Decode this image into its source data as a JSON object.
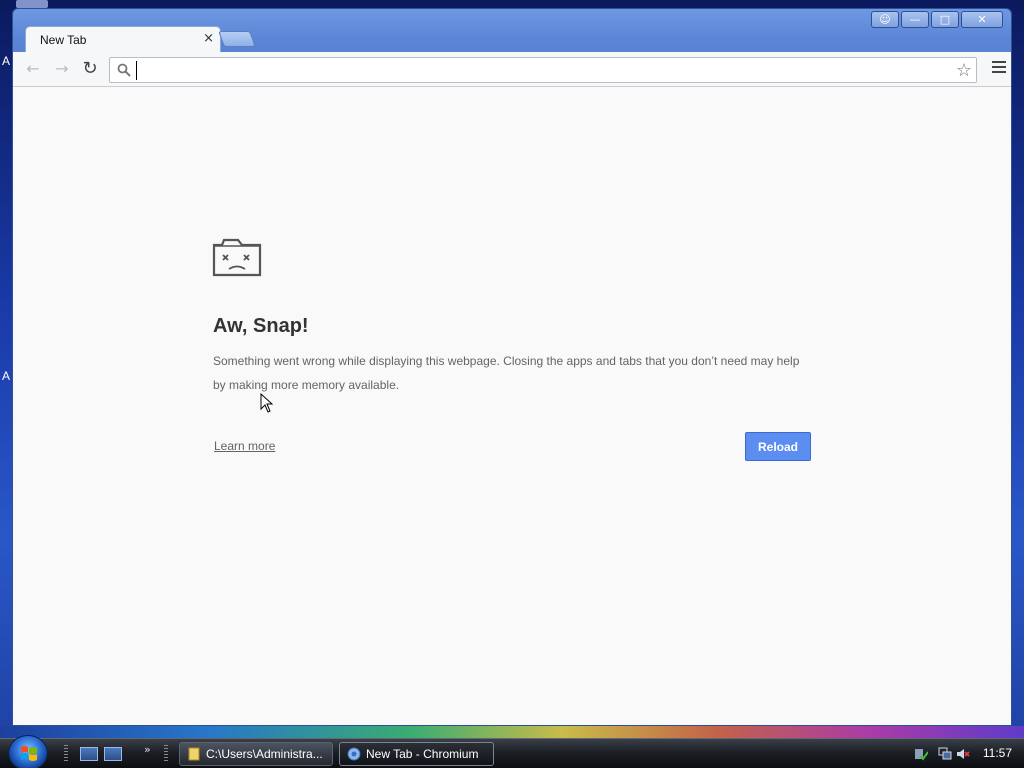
{
  "desktop": {
    "edge_letters": [
      "A",
      "A"
    ]
  },
  "window": {
    "caption_buttons": {
      "user": "☺",
      "minimize": "—",
      "maximize": "□",
      "close": "✕"
    }
  },
  "tabs": [
    {
      "title": "New Tab",
      "close": "×"
    }
  ],
  "toolbar": {
    "back": "←",
    "forward": "→",
    "reload": "↻",
    "omnibox": {
      "value": "",
      "placeholder": ""
    },
    "bookmark_star": "☆"
  },
  "error_page": {
    "icon": "sad-tab-icon",
    "title": "Aw, Snap!",
    "message": "Something went wrong while displaying this webpage. Closing the apps and tabs that you don’t need may help by making more memory available.",
    "learn_more": "Learn more",
    "reload": "Reload"
  },
  "taskbar": {
    "quick_launch_more": "»",
    "buttons": [
      {
        "label": "C:\\Users\\Administra...",
        "icon": "folder-icon"
      },
      {
        "label": "New Tab - Chromium",
        "icon": "chromium-icon",
        "active": true
      }
    ],
    "clock": "11:57"
  },
  "colors": {
    "accent": "#5b8ef0",
    "window_frame": "#5b86d6",
    "content_bg": "#f9f9f9"
  }
}
